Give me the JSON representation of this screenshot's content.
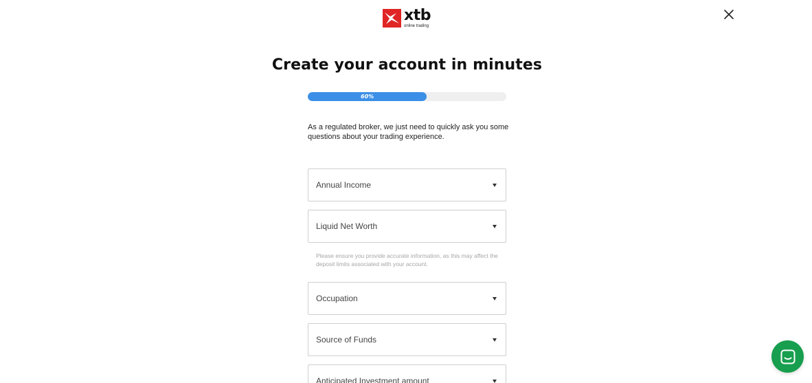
{
  "brand": {
    "name": "xtb",
    "tagline": "online trading",
    "logo_icon": "xtb-logo-icon",
    "accent_color": "#e02525"
  },
  "header": {
    "close_icon": "close-icon"
  },
  "title": "Create your account in minutes",
  "progress": {
    "label": "60%",
    "value": 0.6,
    "color": "#3b8fe6"
  },
  "intro": "As a regulated broker, we just need to quickly ask you some questions about your trading experience.",
  "fields": {
    "annual_income": "Annual Income",
    "liquid_net_worth": "Liquid Net Worth",
    "helper": "Please ensure you provide accurate information, as this may affect the deposit limits associated with your account.",
    "occupation": "Occupation",
    "source_of_funds": "Source of Funds",
    "anticipated_investment": "Anticipated Investment amount"
  },
  "chat": {
    "icon": "chat-icon",
    "color": "#179e4e"
  }
}
